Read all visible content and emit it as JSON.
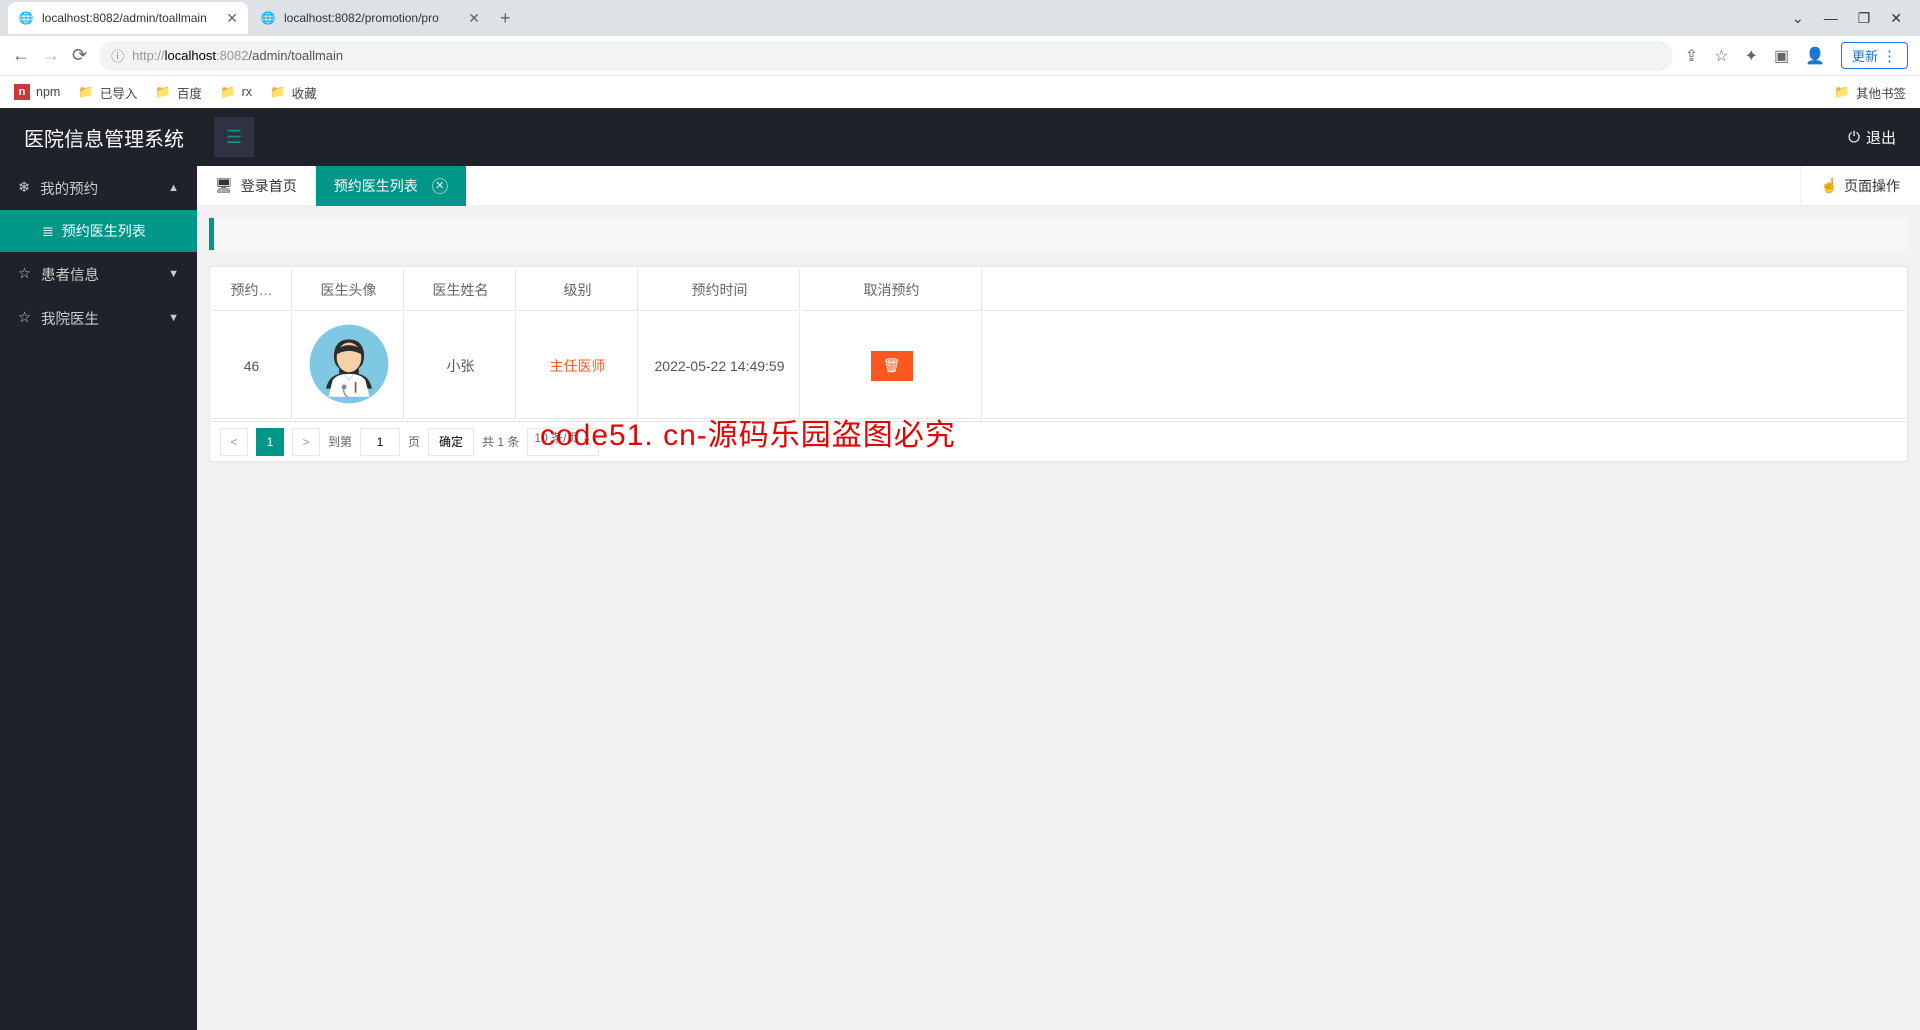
{
  "browser": {
    "tabs": [
      {
        "title": "localhost:8082/admin/toallmain",
        "active": true
      },
      {
        "title": "localhost:8082/promotion/pro",
        "active": false
      }
    ],
    "url_prefix": "http://",
    "url_host": "localhost",
    "url_port": ":8082",
    "url_path": "/admin/toallmain",
    "update_label": "更新",
    "bookmarks": [
      {
        "label": "npm",
        "type": "npm"
      },
      {
        "label": "已导入",
        "type": "folder"
      },
      {
        "label": "百度",
        "type": "folder"
      },
      {
        "label": "rx",
        "type": "folder"
      },
      {
        "label": "收藏",
        "type": "folder"
      }
    ],
    "other_bookmarks": "其他书签"
  },
  "app": {
    "brand": "医院信息管理系统",
    "logout_label": "退出",
    "sidebar": {
      "items": [
        {
          "label": "我的预约",
          "expanded": true,
          "icon": "❄"
        },
        {
          "label": "患者信息",
          "expanded": false,
          "icon": "☆"
        },
        {
          "label": "我院医生",
          "expanded": false,
          "icon": "☆"
        }
      ],
      "submenu_label": "预约医生列表"
    },
    "tabs": {
      "home_label": "登录首页",
      "active_label": "预约医生列表",
      "page_actions": "页面操作"
    },
    "table": {
      "headers": [
        "预约…",
        "医生头像",
        "医生姓名",
        "级别",
        "预约时间",
        "取消预约"
      ],
      "rows": [
        {
          "id": "46",
          "name": "小张",
          "level": "主任医师",
          "time": "2022-05-22 14:49:59"
        }
      ]
    },
    "pagination": {
      "current": "1",
      "goto_prefix": "到第",
      "goto_value": "1",
      "goto_suffix": "页",
      "confirm_label": "确定",
      "total_label": "共 1 条",
      "pagesize_label": "10 条/页"
    }
  },
  "watermark": "code51. cn-源码乐园盗图必究"
}
